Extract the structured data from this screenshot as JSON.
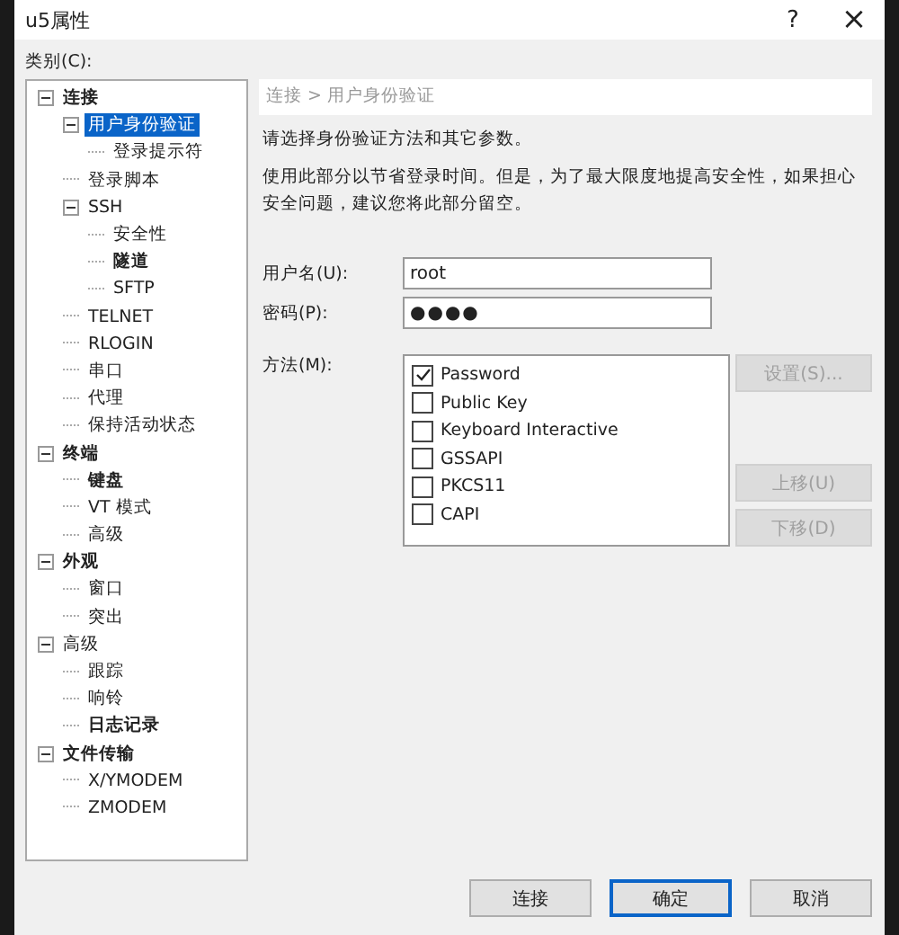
{
  "window": {
    "title": "u5属性",
    "help": "?",
    "close": "×"
  },
  "category_label": "类别(C):",
  "tree": [
    {
      "label": "连接",
      "bold": true,
      "selected": false,
      "expanded": true,
      "children": [
        {
          "label": "用户身份验证",
          "bold": false,
          "selected": true,
          "expanded": true,
          "children": [
            {
              "label": "登录提示符",
              "bold": false,
              "selected": false
            }
          ]
        },
        {
          "label": "登录脚本",
          "bold": false,
          "selected": false
        },
        {
          "label": "SSH",
          "bold": false,
          "selected": false,
          "expanded": true,
          "children": [
            {
              "label": "安全性",
              "bold": false,
              "selected": false
            },
            {
              "label": "隧道",
              "bold": true,
              "selected": false
            },
            {
              "label": "SFTP",
              "bold": false,
              "selected": false
            }
          ]
        },
        {
          "label": "TELNET",
          "bold": false,
          "selected": false
        },
        {
          "label": "RLOGIN",
          "bold": false,
          "selected": false
        },
        {
          "label": "串口",
          "bold": false,
          "selected": false
        },
        {
          "label": "代理",
          "bold": false,
          "selected": false
        },
        {
          "label": "保持活动状态",
          "bold": false,
          "selected": false
        }
      ]
    },
    {
      "label": "终端",
      "bold": true,
      "selected": false,
      "expanded": true,
      "children": [
        {
          "label": "键盘",
          "bold": true,
          "selected": false
        },
        {
          "label": "VT 模式",
          "bold": false,
          "selected": false
        },
        {
          "label": "高级",
          "bold": false,
          "selected": false
        }
      ]
    },
    {
      "label": "外观",
      "bold": true,
      "selected": false,
      "expanded": true,
      "children": [
        {
          "label": "窗口",
          "bold": false,
          "selected": false
        },
        {
          "label": "突出",
          "bold": false,
          "selected": false
        }
      ]
    },
    {
      "label": "高级",
      "bold": false,
      "selected": false,
      "expanded": true,
      "children": [
        {
          "label": "跟踪",
          "bold": false,
          "selected": false
        },
        {
          "label": "响铃",
          "bold": false,
          "selected": false
        },
        {
          "label": "日志记录",
          "bold": true,
          "selected": false
        }
      ]
    },
    {
      "label": "文件传输",
      "bold": true,
      "selected": false,
      "expanded": true,
      "children": [
        {
          "label": "X/YMODEM",
          "bold": false,
          "selected": false
        },
        {
          "label": "ZMODEM",
          "bold": false,
          "selected": false
        }
      ]
    }
  ],
  "breadcrumb": "连接 > 用户身份验证",
  "intro": "请选择身份验证方法和其它参数。",
  "note": "使用此部分以节省登录时间。但是，为了最大限度地提高安全性，如果担心安全问题，建议您将此部分留空。",
  "username": {
    "label": "用户名(U):",
    "value": "root"
  },
  "password": {
    "label": "密码(P):",
    "value": "●●●●"
  },
  "methods_label": "方法(M):",
  "methods": [
    {
      "label": "Password",
      "checked": true
    },
    {
      "label": "Public Key",
      "checked": false
    },
    {
      "label": "Keyboard Interactive",
      "checked": false
    },
    {
      "label": "GSSAPI",
      "checked": false
    },
    {
      "label": "PKCS11",
      "checked": false
    },
    {
      "label": "CAPI",
      "checked": false
    }
  ],
  "side_buttons": [
    {
      "label": "设置(S)...",
      "disabled": true
    },
    {
      "label": "上移(U)",
      "disabled": true
    },
    {
      "label": "下移(D)",
      "disabled": true
    }
  ],
  "footer_buttons": [
    {
      "label": "连接",
      "default": false
    },
    {
      "label": "确定",
      "default": true
    },
    {
      "label": "取消",
      "default": false
    }
  ]
}
